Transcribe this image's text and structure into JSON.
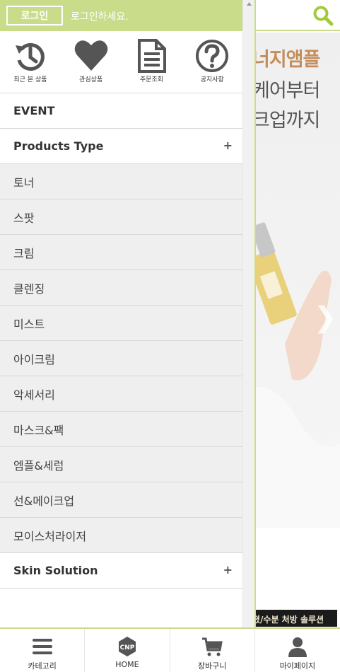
{
  "background": {
    "banner_lines": [
      "너지앰플",
      "케어부터",
      "크업까지"
    ],
    "strip_text": "졌/수분 처방 솔루션",
    "next_glyph": "❯",
    "search_icon": "search-icon"
  },
  "drawer": {
    "login_button": "로그인",
    "login_message": "로그인하세요.",
    "quick_links": [
      {
        "label": "최근 본 상품",
        "icon": "history-icon"
      },
      {
        "label": "관심상품",
        "icon": "heart-icon"
      },
      {
        "label": "주문조회",
        "icon": "document-icon"
      },
      {
        "label": "공지사항",
        "icon": "question-icon"
      }
    ],
    "menu": {
      "event": "EVENT",
      "products_type": "Products Type",
      "products_type_toggle": "+",
      "categories": [
        "토너",
        "스팟",
        "크림",
        "클렌징",
        "미스트",
        "아이크림",
        "악세서리",
        "마스크&팩",
        "엠플&세럼",
        "선&메이크업",
        "모이스처라이저"
      ],
      "skin_solution": "Skin Solution",
      "skin_solution_toggle": "+"
    }
  },
  "tabbar": {
    "tabs": [
      {
        "label": "카테고리",
        "icon": "menu-icon"
      },
      {
        "label": "HOME",
        "icon": "cnp-logo-icon"
      },
      {
        "label": "장바구니",
        "icon": "cart-icon"
      },
      {
        "label": "마이페이지",
        "icon": "user-icon"
      }
    ]
  },
  "colors": {
    "accent": "#c8dc8a",
    "search": "#a3c93a",
    "menu_sub_bg": "#efefef"
  }
}
